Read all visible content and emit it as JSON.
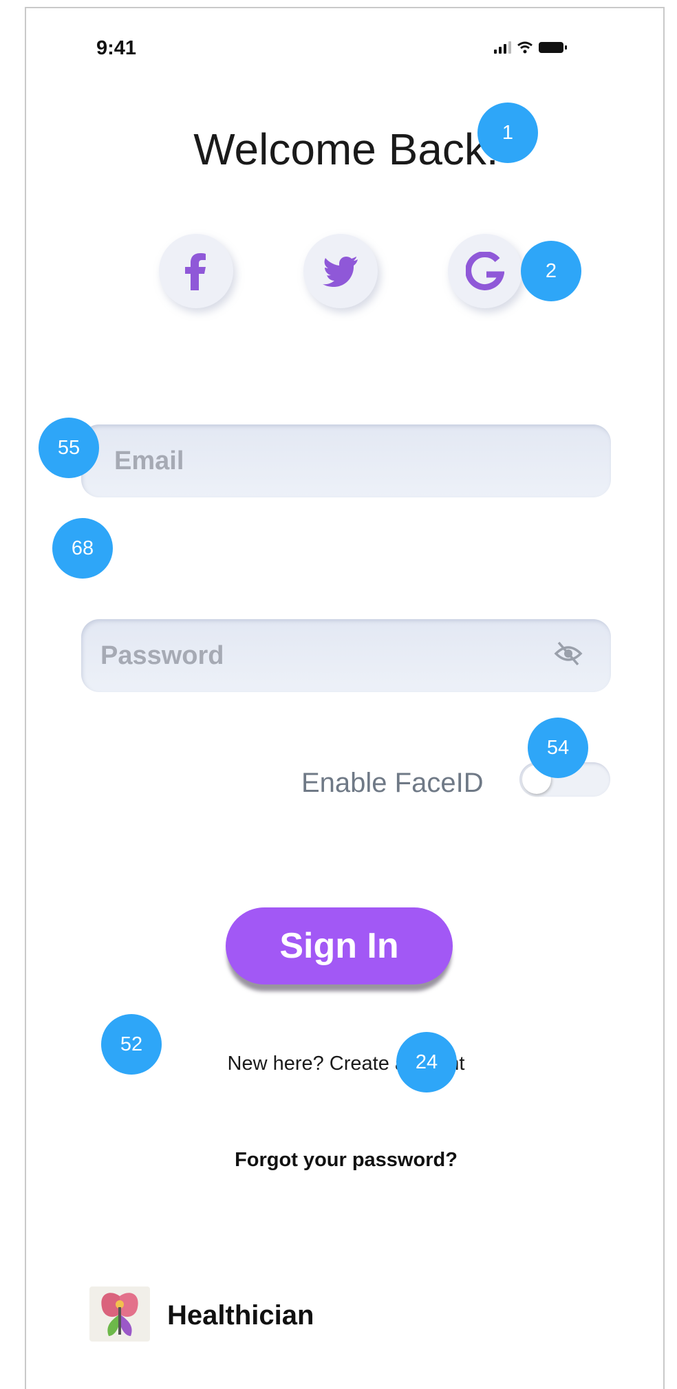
{
  "status_bar": {
    "time": "9:41",
    "icons": [
      "signal-icon",
      "wifi-icon",
      "battery-icon"
    ]
  },
  "title": "Welcome Back!",
  "social": [
    {
      "name": "facebook",
      "icon": "facebook-icon"
    },
    {
      "name": "twitter",
      "icon": "twitter-icon"
    },
    {
      "name": "google",
      "icon": "google-icon"
    }
  ],
  "email": {
    "placeholder": "Email",
    "value": ""
  },
  "password": {
    "placeholder": "Password",
    "value": "",
    "icon": "eye-off-icon"
  },
  "faceid": {
    "label": "Enable FaceID",
    "enabled": false
  },
  "signin_label": "Sign In",
  "create_account": "New here? Create account",
  "forgot_password": "Forgot your password?",
  "brand": {
    "name": "Healthician",
    "logo": "healthician-logo"
  },
  "badges": [
    "1",
    "2",
    "55",
    "68",
    "54",
    "52",
    "24"
  ],
  "colors": {
    "accent": "#a258f5",
    "social_icon": "#8f58d8",
    "badge": "#2ea6f8",
    "field_bg": "#e8ecf5"
  }
}
